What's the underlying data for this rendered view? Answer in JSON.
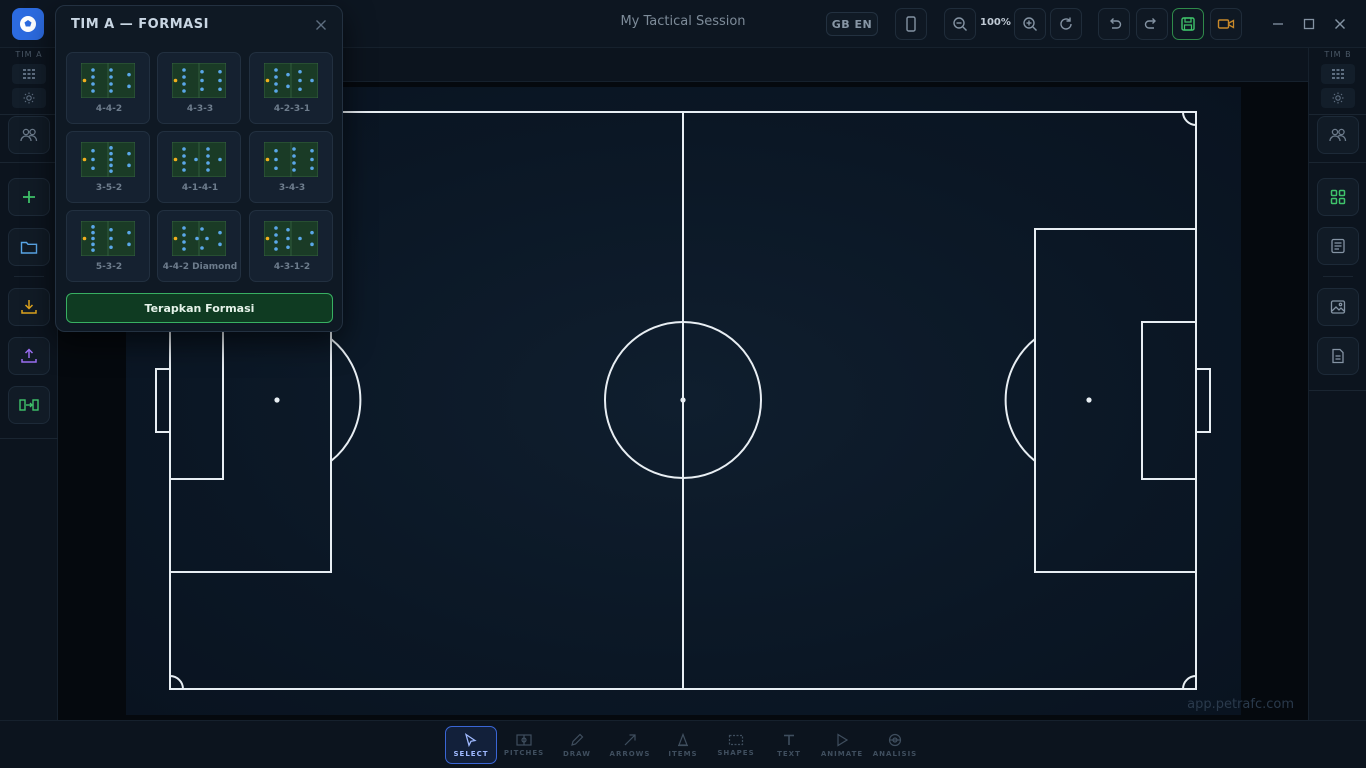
{
  "window": {
    "session_title": "My Tactical Session",
    "language": "GB EN",
    "zoom": "100%"
  },
  "sidebar_left": {
    "team_label": "TIM A"
  },
  "sidebar_right": {
    "team_label": "TIM B"
  },
  "pitch": {
    "watermark": "app.petrafc.com"
  },
  "formation_popup": {
    "title": "TIM A — FORMASI",
    "formations": [
      {
        "name": "4-4-2"
      },
      {
        "name": "4-3-3"
      },
      {
        "name": "4-2-3-1"
      },
      {
        "name": "3-5-2"
      },
      {
        "name": "4-1-4-1"
      },
      {
        "name": "3-4-3"
      },
      {
        "name": "5-3-2"
      },
      {
        "name": "4-4-2 Diamond"
      },
      {
        "name": "4-3-1-2"
      }
    ],
    "apply_label": "Terapkan Formasi"
  },
  "toolbar": {
    "tools": [
      {
        "label": "SELECT",
        "icon": "cursor-icon",
        "active": true
      },
      {
        "label": "PITCHES",
        "icon": "pitch-icon"
      },
      {
        "label": "DRAW",
        "icon": "pencil-icon"
      },
      {
        "label": "ARROWS",
        "icon": "arrow-icon"
      },
      {
        "label": "ITEMS",
        "icon": "cone-icon"
      },
      {
        "label": "SHAPES",
        "icon": "shape-icon"
      },
      {
        "label": "TEXT",
        "icon": "text-icon"
      },
      {
        "label": "ANIMATE",
        "icon": "play-icon"
      },
      {
        "label": "ANALISIS",
        "icon": "analysis-icon"
      }
    ]
  },
  "colors": {
    "accent_blue": "#2c6be0",
    "accent_green": "#38b062",
    "player_blue": "#5aa7e8",
    "goalkeeper": "#f2b01e"
  }
}
